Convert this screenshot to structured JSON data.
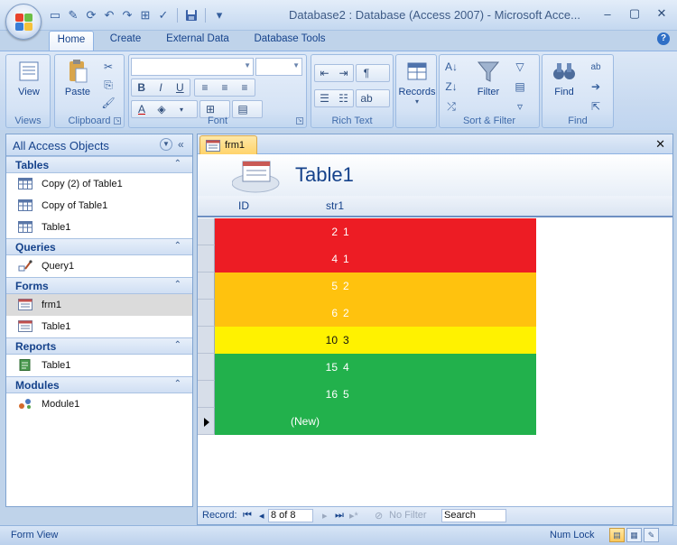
{
  "window": {
    "title": "Database2 : Database (Access 2007) - Microsoft Acce...",
    "controls": [
      "minimize-icon",
      "maximize-icon",
      "close-icon"
    ]
  },
  "quick_access": [
    "new-icon",
    "edit-icon",
    "refresh-icon",
    "undo-icon",
    "redo-icon",
    "format-painter-icon",
    "spell-icon",
    "save-icon",
    "customize-icon"
  ],
  "ribbon_tabs": [
    {
      "label": "Home",
      "active": true
    },
    {
      "label": "Create",
      "active": false
    },
    {
      "label": "External Data",
      "active": false
    },
    {
      "label": "Database Tools",
      "active": false
    }
  ],
  "ribbon": {
    "views": {
      "group": "Views",
      "view_label": "View"
    },
    "clipboard": {
      "group": "Clipboard",
      "paste_label": "Paste"
    },
    "font": {
      "group": "Font",
      "font_name": "",
      "font_size": ""
    },
    "rich_text": {
      "group": "Rich Text"
    },
    "records": {
      "label": "Records"
    },
    "sort_filter": {
      "group": "Sort & Filter",
      "filter_label": "Filter"
    },
    "find": {
      "group": "Find",
      "find_label": "Find"
    }
  },
  "nav_pane": {
    "title": "All Access Objects",
    "categories": [
      {
        "name": "Tables",
        "items": [
          {
            "label": "Copy (2) of Table1",
            "icon": "table-icon"
          },
          {
            "label": "Copy of Table1",
            "icon": "table-icon"
          },
          {
            "label": "Table1",
            "icon": "table-icon"
          }
        ]
      },
      {
        "name": "Queries",
        "items": [
          {
            "label": "Query1",
            "icon": "query-icon"
          }
        ]
      },
      {
        "name": "Forms",
        "items": [
          {
            "label": "frm1",
            "icon": "form-icon",
            "selected": true
          },
          {
            "label": "Table1",
            "icon": "form-icon"
          }
        ]
      },
      {
        "name": "Reports",
        "items": [
          {
            "label": "Table1",
            "icon": "report-icon"
          }
        ]
      },
      {
        "name": "Modules",
        "items": [
          {
            "label": "Module1",
            "icon": "module-icon"
          }
        ]
      }
    ]
  },
  "document": {
    "tab_label": "frm1",
    "form_title": "Table1",
    "columns": [
      "ID",
      "str1"
    ],
    "rows": [
      {
        "id": "2",
        "str": "1",
        "color": "#ed1c24"
      },
      {
        "id": "4",
        "str": "1",
        "color": "#ed1c24"
      },
      {
        "id": "5",
        "str": "2",
        "color": "#ffc20e"
      },
      {
        "id": "6",
        "str": "2",
        "color": "#ffc20e"
      },
      {
        "id": "10",
        "str": "3",
        "color": "#fff200",
        "dark": true
      },
      {
        "id": "15",
        "str": "4",
        "color": "#22b14c"
      },
      {
        "id": "16",
        "str": "5",
        "color": "#22b14c"
      },
      {
        "id": "(New)",
        "str": "",
        "color": "#22b14c",
        "current": true
      }
    ],
    "record_nav": {
      "label": "Record:",
      "position": "8 of 8",
      "filter": "No Filter",
      "search": "Search"
    }
  },
  "status_bar": {
    "mode": "Form View",
    "numlock": "Num Lock"
  }
}
